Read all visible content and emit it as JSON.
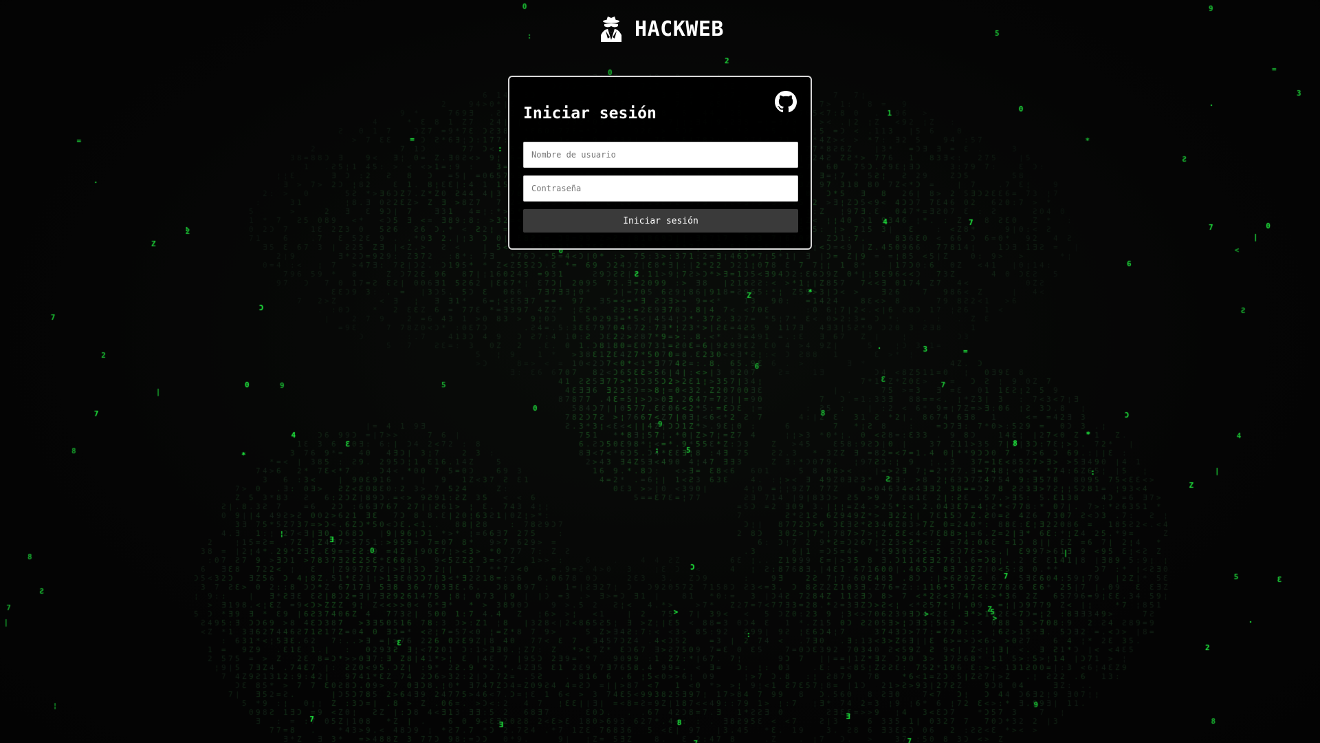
{
  "brand": {
    "name": "HACKWEB",
    "logo_icon": "hacker-spy-icon"
  },
  "login": {
    "title": "Iniciar sesión",
    "github_icon": "github-icon",
    "username_placeholder": "Nombre de usuario",
    "username_value": "",
    "password_placeholder": "Contraseña",
    "password_value": "",
    "submit_label": "Iniciar sesión"
  },
  "theme": {
    "background": "#050505",
    "matrix_green": "#22ff44",
    "card_border": "#d9d9d9",
    "button_bg": "#3a3a3a"
  },
  "background_effect": {
    "name": "matrix-rain",
    "glyphs": "0123456789ZƐ7:.=*<>¦|ƎƆƧ"
  }
}
